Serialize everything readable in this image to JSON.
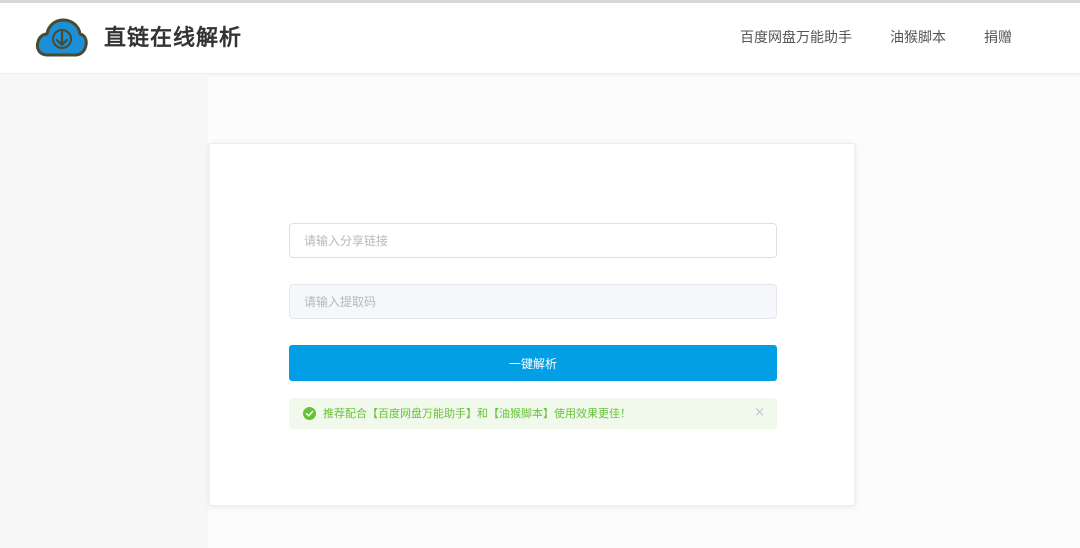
{
  "header": {
    "brand_title": "直链在线解析",
    "nav": [
      {
        "label": "百度网盘万能助手"
      },
      {
        "label": "油猴脚本"
      },
      {
        "label": "捐赠"
      }
    ]
  },
  "form": {
    "link_placeholder": "请输入分享链接",
    "link_value": "",
    "code_placeholder": "请输入提取码",
    "code_value": "",
    "submit_label": "一键解析"
  },
  "alert": {
    "message": "推荐配合【百度网盘万能助手】和【油猴脚本】使用效果更佳！",
    "close_glyph": "×",
    "icon": "check-circle-icon",
    "type": "success"
  },
  "colors": {
    "primary": "#039fe5",
    "success": "#67c23a",
    "logo_blue": "#1d8fd6",
    "logo_outline": "#4a4a2e"
  }
}
